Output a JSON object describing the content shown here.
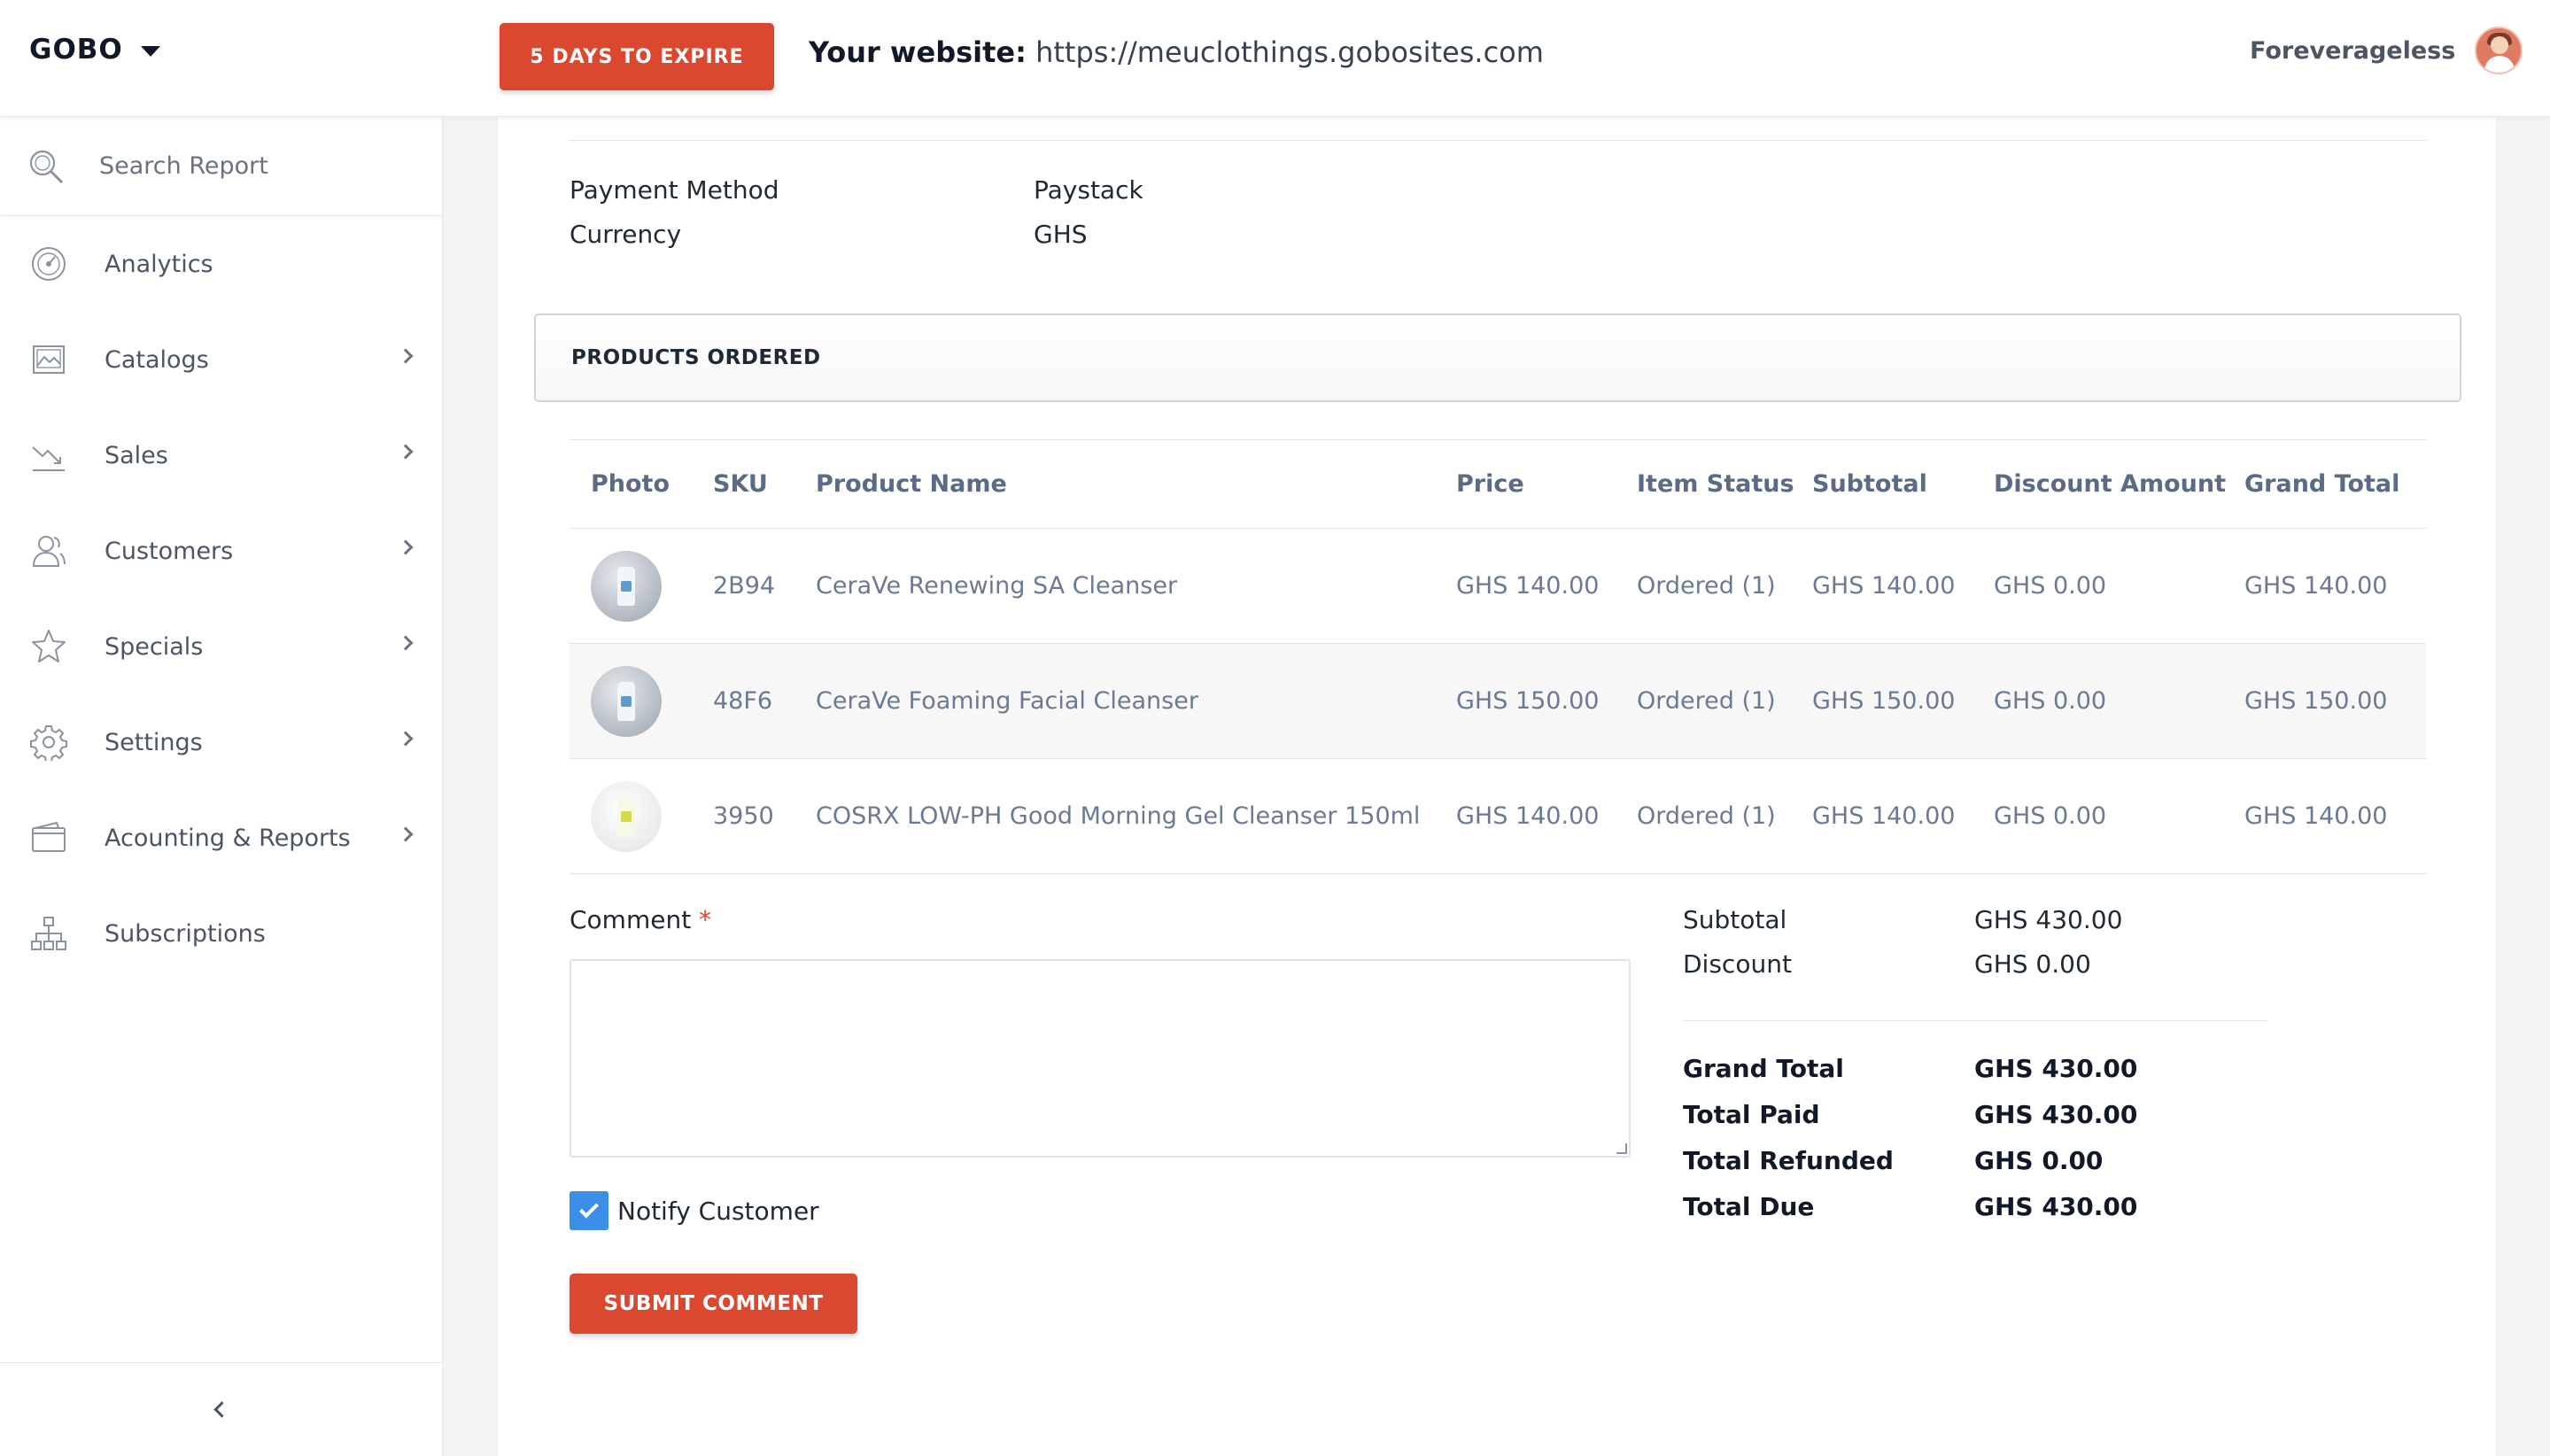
{
  "topbar": {
    "brand": "GOBO",
    "expire_label": "5 DAYS TO EXPIRE",
    "website_label": "Your website:",
    "website_url": "https://meuclothings.gobosites.com",
    "user_name": "Foreverageless"
  },
  "sidebar": {
    "search_placeholder": "Search Report",
    "items": [
      {
        "label": "Analytics",
        "icon": "gauge-icon",
        "has_submenu": false
      },
      {
        "label": "Catalogs",
        "icon": "image-icon",
        "has_submenu": true
      },
      {
        "label": "Sales",
        "icon": "trend-down-icon",
        "has_submenu": true
      },
      {
        "label": "Customers",
        "icon": "users-icon",
        "has_submenu": true
      },
      {
        "label": "Specials",
        "icon": "star-icon",
        "has_submenu": true
      },
      {
        "label": "Settings",
        "icon": "gear-icon",
        "has_submenu": true
      },
      {
        "label": "Acounting & Reports",
        "icon": "wallet-icon",
        "has_submenu": true
      },
      {
        "label": "Subscriptions",
        "icon": "sitemap-icon",
        "has_submenu": false
      }
    ]
  },
  "order_info": {
    "payment_method_label": "Payment Method",
    "payment_method": "Paystack",
    "currency_label": "Currency",
    "currency": "GHS"
  },
  "products": {
    "section_title": "PRODUCTS ORDERED",
    "columns": [
      "Photo",
      "SKU",
      "Product Name",
      "Price",
      "Item Status",
      "Subtotal",
      "Discount Amount",
      "Grand Total"
    ],
    "rows": [
      {
        "sku": "2B94",
        "name": "CeraVe Renewing SA Cleanser",
        "price": "GHS 140.00",
        "status": "Ordered (1)",
        "subtotal": "GHS 140.00",
        "discount": "GHS 0.00",
        "grand_total": "GHS 140.00"
      },
      {
        "sku": "48F6",
        "name": "CeraVe Foaming Facial Cleanser",
        "price": "GHS 150.00",
        "status": "Ordered (1)",
        "subtotal": "GHS 150.00",
        "discount": "GHS 0.00",
        "grand_total": "GHS 150.00"
      },
      {
        "sku": "3950",
        "name": "COSRX LOW-PH Good Morning Gel Cleanser 150ml",
        "price": "GHS 140.00",
        "status": "Ordered (1)",
        "subtotal": "GHS 140.00",
        "discount": "GHS 0.00",
        "grand_total": "GHS 140.00"
      }
    ]
  },
  "comment": {
    "label": "Comment",
    "required_mark": "*",
    "value": "",
    "notify_label": "Notify Customer",
    "notify_checked": true,
    "submit_label": "SUBMIT COMMENT"
  },
  "totals": {
    "subtotal_label": "Subtotal",
    "subtotal": "GHS 430.00",
    "discount_label": "Discount",
    "discount": "GHS 0.00",
    "grand_total_label": "Grand Total",
    "grand_total": "GHS 430.00",
    "total_paid_label": "Total Paid",
    "total_paid": "GHS 430.00",
    "total_refunded_label": "Total Refunded",
    "total_refunded": "GHS 0.00",
    "total_due_label": "Total Due",
    "total_due": "GHS 430.00"
  },
  "colors": {
    "accent": "#d9482f",
    "checkbox": "#3b8fe8",
    "table_text": "#6b7a94"
  }
}
